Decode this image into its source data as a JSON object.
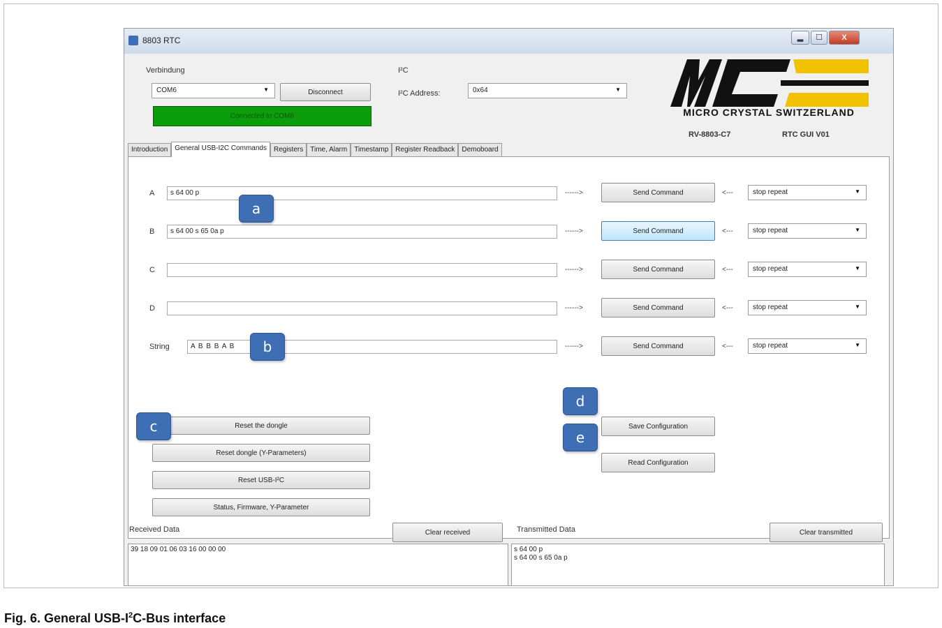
{
  "window": {
    "title": "8803 RTC",
    "buttons": {
      "minimize": "▂",
      "maximize": "☐",
      "close": "X"
    }
  },
  "connection": {
    "group_label": "Verbindung",
    "port_value": "COM6",
    "disconnect_label": "Disconnect",
    "status_text": "Connected to COM6",
    "status_color": "#0b9d0b"
  },
  "i2c": {
    "group_label": "I²C",
    "address_label": "I²C Address:",
    "address_value": "0x64"
  },
  "logo": {
    "caption": "MICRO CRYSTAL SWITZERLAND",
    "black": "#111111",
    "yellow": "#f2c200",
    "model": "RV-8803-C7",
    "gui_version": "RTC GUI V01"
  },
  "tabs": [
    {
      "label": "Introduction"
    },
    {
      "label": "General USB-I2C Commands"
    },
    {
      "label": "Registers"
    },
    {
      "label": "Time, Alarm"
    },
    {
      "label": "Timestamp"
    },
    {
      "label": "Register Readback"
    },
    {
      "label": "Demoboard"
    }
  ],
  "commands": {
    "arrow_right": "------>",
    "arrow_left": "<---",
    "send_label": "Send Command",
    "repeat_value": "stop repeat",
    "rows": [
      {
        "letter": "A",
        "value": "s 64 00 p"
      },
      {
        "letter": "B",
        "value": "s 64 00 s 65 0a p"
      },
      {
        "letter": "C",
        "value": ""
      },
      {
        "letter": "D",
        "value": ""
      },
      {
        "letter": "String",
        "value": "A B B B A B"
      }
    ]
  },
  "action_buttons": {
    "reset_dongle": "Reset the dongle",
    "reset_dongle_y": "Reset dongle (Y-Parameters)",
    "reset_usb_i2c": "Reset USB-I²C",
    "status_firmware": "Status, Firmware, Y-Parameter",
    "save_config": "Save Configuration",
    "read_config": "Read Configuration"
  },
  "badges": {
    "a": "a",
    "b": "b",
    "c": "c",
    "d": "d",
    "e": "e",
    "color": "#3e6fb4"
  },
  "received": {
    "label": "Received Data",
    "clear_label": "Clear received",
    "content": "39 18 09 01 06 03 16 00 00 00"
  },
  "transmitted": {
    "label": "Transmitted Data",
    "clear_label": "Clear transmitted",
    "lines": [
      "s 64 00 p",
      "s 64 00 s 65 0a p"
    ]
  },
  "caption": {
    "prefix": "Fig. 6.  General USB-I",
    "superscript": "2",
    "suffix": "C-Bus interface"
  }
}
